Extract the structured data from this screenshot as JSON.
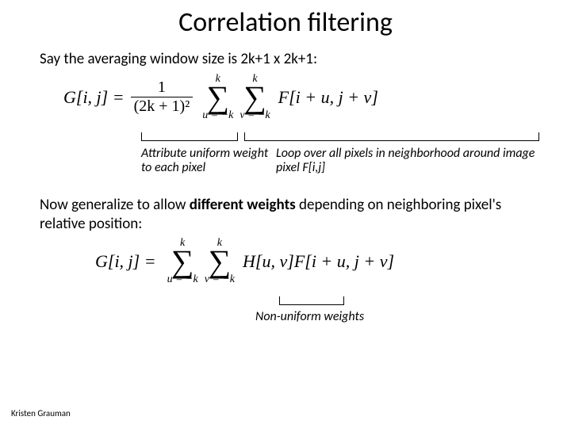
{
  "title": "Correlation filtering",
  "line1": "Say the averaging window size is 2k+1 x 2k+1:",
  "eq1": {
    "lhs": "G[i, j] =",
    "frac_num": "1",
    "frac_den": "(2k + 1)²",
    "sum1_top": "k",
    "sum1_bot": "u = −k",
    "sum2_top": "k",
    "sum2_bot": "v = −k",
    "rhs": "F[i + u, j + v]"
  },
  "ann1a": "Attribute uniform weight to each pixel",
  "ann1b": "Loop over all pixels in neighborhood around image pixel F[i,j]",
  "line2a": "Now generalize to allow ",
  "line2b": "different weights",
  "line2c": " depending on neighboring pixel's relative position:",
  "eq2": {
    "lhs": "G[i, j] =",
    "sum1_top": "k",
    "sum1_bot": "u = −k",
    "sum2_top": "k",
    "sum2_bot": "v = −k",
    "h": "H[u, v]",
    "f": "F[i + u, j + v]"
  },
  "ann2": "Non-uniform weights",
  "credit": "Kristen Grauman"
}
